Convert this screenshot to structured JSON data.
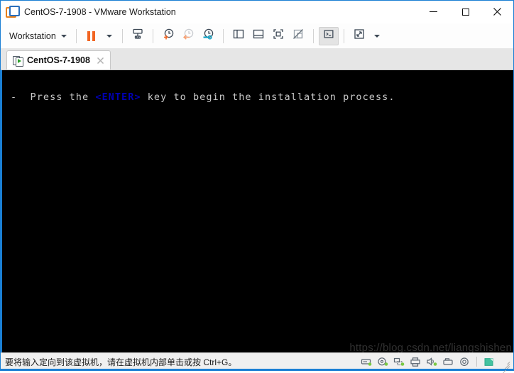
{
  "window": {
    "title": "CentOS-7-1908 - VMware Workstation",
    "app_icon": "vmware-workstation-icon",
    "controls": {
      "minimize": "Minimize",
      "maximize": "Maximize",
      "close": "Close"
    },
    "accent_color": "#1a7fd4"
  },
  "toolbar": {
    "menu_label": "Workstation",
    "buttons": [
      {
        "name": "pause-vm-button",
        "icon": "pause-icon",
        "tooltip": "Suspend"
      },
      {
        "name": "send-ctrl-alt-del-button",
        "icon": "send-keys-icon",
        "tooltip": "Send Ctrl+Alt+Delete"
      },
      {
        "name": "take-snapshot-button",
        "icon": "snapshot-add-icon",
        "tooltip": "Take snapshot"
      },
      {
        "name": "revert-snapshot-button",
        "icon": "snapshot-revert-icon",
        "tooltip": "Revert to snapshot"
      },
      {
        "name": "snapshot-manager-button",
        "icon": "snapshot-manager-icon",
        "tooltip": "Manage snapshots"
      },
      {
        "name": "show-library-button",
        "icon": "library-panel-icon",
        "tooltip": "Show or hide the library"
      },
      {
        "name": "show-thumbnails-button",
        "icon": "thumbnail-bar-icon",
        "tooltip": "Show or hide thumbnails"
      },
      {
        "name": "fullscreen-button",
        "icon": "fullscreen-icon",
        "tooltip": "Enter full screen mode"
      },
      {
        "name": "unity-mode-button",
        "icon": "unity-mode-disabled-icon",
        "tooltip": "Unity mode"
      },
      {
        "name": "console-view-button",
        "icon": "console-view-icon",
        "tooltip": "Console view"
      },
      {
        "name": "stretch-guest-button",
        "icon": "stretch-arrows-icon",
        "tooltip": "Stretch guest display"
      }
    ],
    "pause_color": "#f26522",
    "snapshot_accent": "#f26522",
    "snapshot_manager_accent": "#18a6c8"
  },
  "tabs": [
    {
      "name": "tab-centos",
      "label": "CentOS-7-1908",
      "icon": "vm-powered-on-icon",
      "close_icon": "close-icon",
      "active": true
    }
  ],
  "console": {
    "prefix": "-  Press the ",
    "key": "<ENTER>",
    "suffix": " key to begin the installation process.",
    "text_color": "#c9c9c9",
    "key_color": "#0000b4",
    "background": "#000000",
    "watermark": "https://blog.csdn.net/liangshishen"
  },
  "statusbar": {
    "message": "要将输入定向到该虚拟机，请在虚拟机内部单击或按 Ctrl+G。",
    "devices": [
      {
        "name": "status-hard-disk-icon",
        "icon": "hard-disk-icon",
        "connected": true
      },
      {
        "name": "status-cd-dvd-icon",
        "icon": "cd-dvd-icon",
        "connected": true
      },
      {
        "name": "status-network-icon",
        "icon": "network-adapter-icon",
        "connected": true
      },
      {
        "name": "status-printer-icon",
        "icon": "printer-icon",
        "connected": false
      },
      {
        "name": "status-sound-icon",
        "icon": "sound-card-icon",
        "connected": true
      },
      {
        "name": "status-usb-icon",
        "icon": "usb-controller-icon",
        "connected": false
      },
      {
        "name": "status-floppy-icon",
        "icon": "floppy-disk-icon",
        "connected": false
      },
      {
        "name": "status-input-icon",
        "icon": "input-capture-icon",
        "connected": false
      }
    ],
    "indicator_color": "#7ac943",
    "resize_grip": "resize-grip-icon"
  }
}
